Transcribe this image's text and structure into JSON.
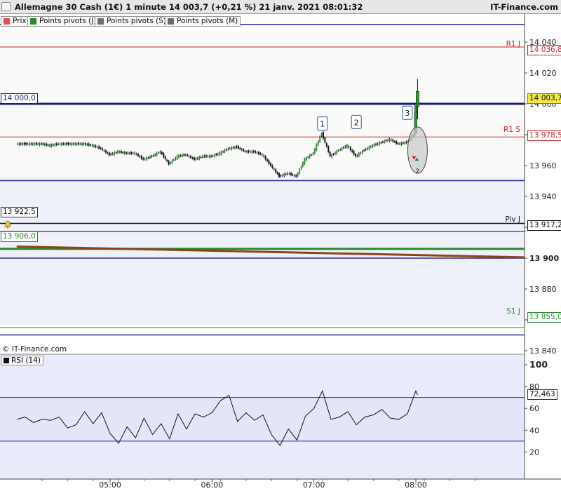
{
  "header": {
    "title": "Allemagne 30 Cash (1€) 1 minute 14 003,7 (+0,21 %) 21 janv. 2021 08:01:32",
    "brand": "IT-Finance.com"
  },
  "legend": [
    {
      "label": "Prix",
      "color": "#e05050"
    },
    {
      "label": "Points pivots (J)",
      "color": "#2a8a2a"
    },
    {
      "label": "Points pivots (S)",
      "color": "#6b6b6b"
    },
    {
      "label": "Points pivots (M)",
      "color": "#6b6b6b"
    }
  ],
  "watermark": "© IT-Finance.com",
  "left_labels": {
    "open_level": "14 000,0",
    "low_level": "13 922,5",
    "month_pivot": "13 906,0"
  },
  "pivots": [
    {
      "name": "R1 J",
      "value_label": "14 036,8",
      "color": "#d02020"
    },
    {
      "name": "R1 S",
      "value_label": "13 978,5",
      "color": "#d02020"
    },
    {
      "name": "Piv J",
      "value_label": "13 917,2",
      "color": "#111111"
    },
    {
      "name": "S1 J",
      "value_label": "13 855,0",
      "color": "#2a8a2a"
    }
  ],
  "current_price_label": "14 003,7",
  "rsi_label": "RSI (14)",
  "rsi_value_label": "72,463",
  "annotations": [
    "1",
    "2",
    "3"
  ],
  "signal_count": "2",
  "chart_data": [
    {
      "type": "candlestick",
      "title": "Allemagne 30 Cash (1€) 1 minute",
      "x_tick_labels": [
        "05:00",
        "06:00",
        "07:00",
        "08:00"
      ],
      "x_range": [
        "04:05",
        "08:40"
      ],
      "y_tick_labels": [
        "14 060",
        "14 040",
        "14 020",
        "14 000",
        "13 980",
        "13 960",
        "13 940",
        "13 920",
        "13 900",
        "13 880",
        "13 860",
        "13 840"
      ],
      "ylim": [
        13832,
        14062
      ],
      "grid": false,
      "horizontal_levels": [
        {
          "name": "R1 J",
          "value": 14036.8,
          "color": "#d02020"
        },
        {
          "name": "R1 S",
          "value": 13978.5,
          "color": "#d02020"
        },
        {
          "name": "Piv J",
          "value": 13917.2,
          "color": "#111111"
        },
        {
          "name": "S1 J",
          "value": 13855.0,
          "color": "#2a8a2a"
        },
        {
          "name": "",
          "value": 14051.5,
          "color": "#2828a0"
        },
        {
          "name": "",
          "value": 14000.0,
          "color": "#1a1a80"
        },
        {
          "name": "",
          "value": 13950.2,
          "color": "#2828a0"
        },
        {
          "name": "",
          "value": 13922.5,
          "color": "#111111"
        },
        {
          "name": "",
          "value": 13906.0,
          "color": "#2a8a2a"
        },
        {
          "name": "",
          "value": 13900.0,
          "color": "#2828a0"
        },
        {
          "name": "",
          "value": 13850.2,
          "color": "#2828a0"
        }
      ],
      "trendline": {
        "from": [
          "04:05",
          13907.5
        ],
        "to": [
          "08:40",
          13900.5
        ],
        "color": "#8b4513"
      },
      "close_series": [
        [
          "04:05",
          13974
        ],
        [
          "04:10",
          13974
        ],
        [
          "04:15",
          13974
        ],
        [
          "04:20",
          13974
        ],
        [
          "04:25",
          13973
        ],
        [
          "04:30",
          13974
        ],
        [
          "04:35",
          13974
        ],
        [
          "04:40",
          13974
        ],
        [
          "04:45",
          13974
        ],
        [
          "04:50",
          13973
        ],
        [
          "04:55",
          13971
        ],
        [
          "05:00",
          13967
        ],
        [
          "05:05",
          13969
        ],
        [
          "05:10",
          13968
        ],
        [
          "05:15",
          13968
        ],
        [
          "05:20",
          13964
        ],
        [
          "05:25",
          13966
        ],
        [
          "05:30",
          13969
        ],
        [
          "05:35",
          13961
        ],
        [
          "05:40",
          13966
        ],
        [
          "05:45",
          13967
        ],
        [
          "05:50",
          13964
        ],
        [
          "05:55",
          13966
        ],
        [
          "06:00",
          13966
        ],
        [
          "06:05",
          13968
        ],
        [
          "06:10",
          13971
        ],
        [
          "06:15",
          13972
        ],
        [
          "06:20",
          13969
        ],
        [
          "06:25",
          13969
        ],
        [
          "06:30",
          13967
        ],
        [
          "06:35",
          13960
        ],
        [
          "06:40",
          13953
        ],
        [
          "06:45",
          13955
        ],
        [
          "06:50",
          13953
        ],
        [
          "06:55",
          13964
        ],
        [
          "07:00",
          13968
        ],
        [
          "07:05",
          13981
        ],
        [
          "07:10",
          13966
        ],
        [
          "07:15",
          13970
        ],
        [
          "07:20",
          13973
        ],
        [
          "07:25",
          13966
        ],
        [
          "07:30",
          13970
        ],
        [
          "07:35",
          13973
        ],
        [
          "07:40",
          13975
        ],
        [
          "07:45",
          13977
        ],
        [
          "07:50",
          13974
        ],
        [
          "07:55",
          13975
        ],
        [
          "07:59",
          13980
        ],
        [
          "08:00",
          13994
        ],
        [
          "08:01",
          14003.7
        ]
      ]
    },
    {
      "type": "line",
      "title": "RSI (14)",
      "x_tick_labels": [
        "05:00",
        "06:00",
        "07:00",
        "08:00"
      ],
      "x_range": [
        "04:05",
        "08:40"
      ],
      "y_tick_labels": [
        "100",
        "80",
        "60",
        "40",
        "20"
      ],
      "ylim": [
        0,
        105
      ],
      "levels": [
        70,
        30
      ],
      "current_value": 72.463,
      "series": [
        [
          "04:05",
          50
        ],
        [
          "04:10",
          52
        ],
        [
          "04:15",
          47
        ],
        [
          "04:20",
          50
        ],
        [
          "04:25",
          49
        ],
        [
          "04:30",
          52
        ],
        [
          "04:35",
          42
        ],
        [
          "04:40",
          45
        ],
        [
          "04:45",
          57
        ],
        [
          "04:50",
          46
        ],
        [
          "04:55",
          56
        ],
        [
          "05:00",
          37
        ],
        [
          "05:05",
          28
        ],
        [
          "05:10",
          43
        ],
        [
          "05:15",
          33
        ],
        [
          "05:20",
          51
        ],
        [
          "05:25",
          36
        ],
        [
          "05:30",
          46
        ],
        [
          "05:35",
          32
        ],
        [
          "05:40",
          55
        ],
        [
          "05:45",
          41
        ],
        [
          "05:50",
          55
        ],
        [
          "05:55",
          52
        ],
        [
          "06:00",
          56
        ],
        [
          "06:05",
          67
        ],
        [
          "06:10",
          72
        ],
        [
          "06:15",
          48
        ],
        [
          "06:20",
          56
        ],
        [
          "06:25",
          49
        ],
        [
          "06:30",
          54
        ],
        [
          "06:35",
          36
        ],
        [
          "06:40",
          26
        ],
        [
          "06:45",
          41
        ],
        [
          "06:50",
          31
        ],
        [
          "06:55",
          53
        ],
        [
          "07:00",
          60
        ],
        [
          "07:05",
          76
        ],
        [
          "07:10",
          50
        ],
        [
          "07:15",
          52
        ],
        [
          "07:20",
          57
        ],
        [
          "07:25",
          45
        ],
        [
          "07:30",
          52
        ],
        [
          "07:35",
          54
        ],
        [
          "07:40",
          59
        ],
        [
          "07:45",
          51
        ],
        [
          "07:50",
          50
        ],
        [
          "07:55",
          55
        ],
        [
          "08:00",
          76
        ],
        [
          "08:01",
          72.463
        ]
      ]
    }
  ]
}
